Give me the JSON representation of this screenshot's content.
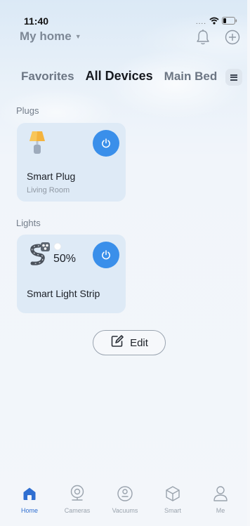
{
  "status_bar": {
    "time": "11:40",
    "signal_dots": "....",
    "wifi_icon": "wifi-icon",
    "battery_icon": "battery-icon"
  },
  "header": {
    "home_label": "My home",
    "dropdown_icon": "caret-down-icon",
    "notification_icon": "bell-icon",
    "add_icon": "add-circle-icon"
  },
  "tabs": {
    "items": [
      {
        "label": "Favorites",
        "active": false
      },
      {
        "label": "All Devices",
        "active": true
      },
      {
        "label": "Main Bed",
        "active": false
      }
    ],
    "menu_icon": "menu-icon"
  },
  "sections": {
    "plugs": {
      "title": "Plugs",
      "device": {
        "name": "Smart Plug",
        "room": "Living Room",
        "icon": "lamp-icon",
        "power_icon": "power-icon"
      }
    },
    "lights": {
      "title": "Lights",
      "device": {
        "name": "Smart Light Strip",
        "brightness": "50%",
        "icon": "light-strip-icon",
        "power_icon": "power-icon"
      }
    }
  },
  "edit": {
    "label": "Edit",
    "icon": "edit-icon"
  },
  "bottom_nav": {
    "items": [
      {
        "label": "Home",
        "icon": "home-icon",
        "active": true
      },
      {
        "label": "Cameras",
        "icon": "camera-icon",
        "active": false
      },
      {
        "label": "Vacuums",
        "icon": "vacuum-icon",
        "active": false
      },
      {
        "label": "Smart",
        "icon": "smart-cube-icon",
        "active": false
      },
      {
        "label": "Me",
        "icon": "person-icon",
        "active": false
      }
    ]
  },
  "colors": {
    "accent": "#3a8fea",
    "active_nav": "#2f6fd1",
    "card_bg": "#dce9f6",
    "muted_text": "#737d8a"
  }
}
